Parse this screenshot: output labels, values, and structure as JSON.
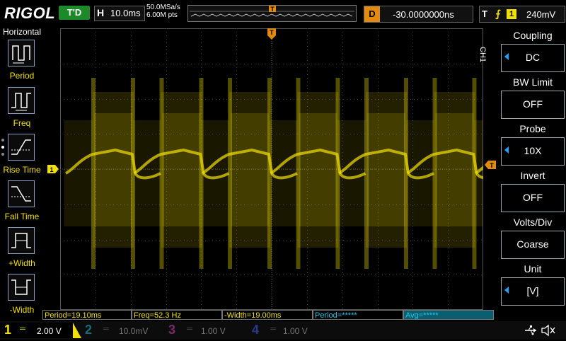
{
  "topbar": {
    "logo": "RIGOL",
    "run_status": "T'D",
    "horizontal_label": "H",
    "timebase": "10.0ms",
    "sample_rate": "50.0MSa/s",
    "memory_depth": "6.00M pts",
    "trigger_marker": "T",
    "delay_label": "D",
    "delay_value": "-30.0000000ns",
    "trigger_label": "T",
    "trigger_slope": "⨍",
    "trigger_channel": "1",
    "trigger_level": "240mV"
  },
  "left_menu": {
    "title": "Horizontal",
    "items": [
      {
        "label": "Period"
      },
      {
        "label": "Freq"
      },
      {
        "label": "Rise Time"
      },
      {
        "label": "Fall Time"
      },
      {
        "label": "+Width"
      },
      {
        "label": "-Width"
      }
    ]
  },
  "right_menu": {
    "channel_label": "CH1",
    "items": [
      {
        "title": "Coupling",
        "value": "DC",
        "has_arrow": true
      },
      {
        "title": "BW Limit",
        "value": "OFF",
        "has_arrow": false
      },
      {
        "title": "Probe",
        "value": "10X",
        "has_arrow": true
      },
      {
        "title": "Invert",
        "value": "OFF",
        "has_arrow": false
      },
      {
        "title": "Volts/Div",
        "value": "Coarse",
        "has_arrow": false
      },
      {
        "title": "Unit",
        "value": "[V]",
        "has_arrow": true
      }
    ]
  },
  "markers": {
    "ch1_ground": "1",
    "trigger_level": "T",
    "trigger_position": "T"
  },
  "measurements": [
    {
      "text": "Period=19.10ms",
      "color": "#f2e000"
    },
    {
      "text": "Freq=52.3 Hz",
      "color": "#f2e000"
    },
    {
      "text": "-Width=19.00ms",
      "color": "#f2e000"
    },
    {
      "text": "Period=*****",
      "color": "#1ec8e6"
    },
    {
      "text": "Avg=*****",
      "color": "#1ec8e6"
    }
  ],
  "channels": [
    {
      "num": "1",
      "scale": "2.00 V",
      "color": "#f2e000",
      "active": true
    },
    {
      "num": "2",
      "scale": "10.0mV",
      "color": "#1ec8e6",
      "active": false
    },
    {
      "num": "3",
      "scale": "1.00 V",
      "color": "#e040c0",
      "active": false
    },
    {
      "num": "4",
      "scale": "1.00 V",
      "color": "#2050e0",
      "active": false
    }
  ],
  "colors": {
    "ch1": "#f2e000",
    "trigger": "#e28a10",
    "run_status_bg": "#1d8a2a",
    "menu_arrow": "#1ea2ff"
  },
  "icons": {
    "usb": "usb-icon",
    "speaker": "speaker-muted-icon"
  }
}
